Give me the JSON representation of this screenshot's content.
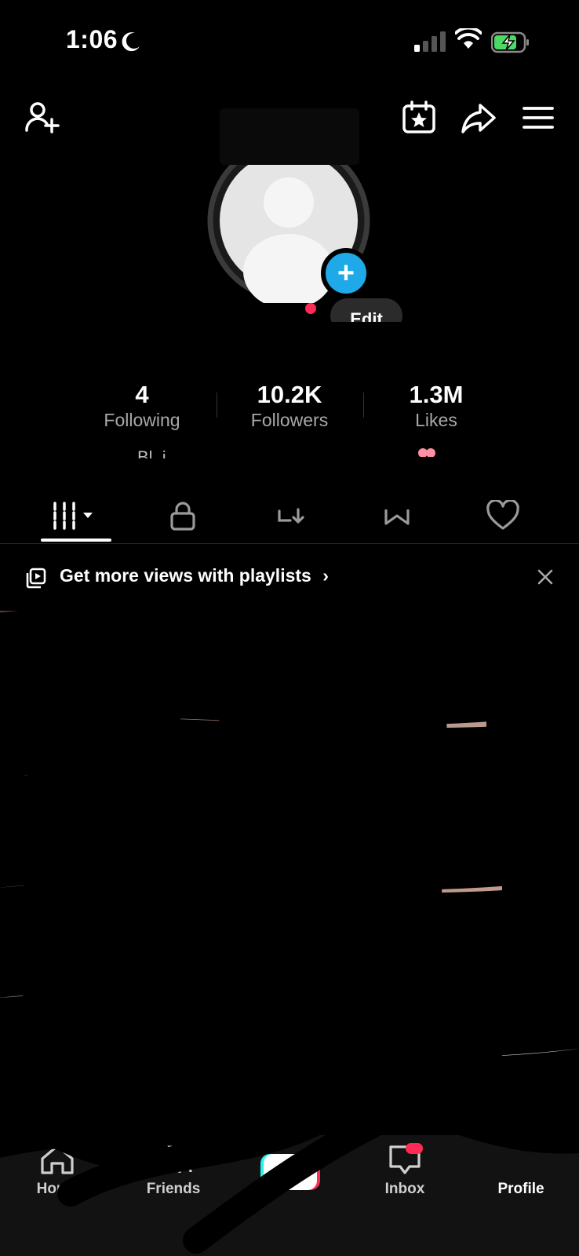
{
  "status_bar": {
    "time": "1:06"
  },
  "header": {
    "icons": [
      "add-friend-icon",
      "calendar-star-icon",
      "share-arrow-icon",
      "menu-icon"
    ]
  },
  "profile": {
    "edit_label": "Edit",
    "add_icon": "plus-icon",
    "accent_color": "#1fa9e8"
  },
  "stats": [
    {
      "value": "4",
      "label": "Following"
    },
    {
      "value": "10.2K",
      "label": "Followers"
    },
    {
      "value": "1.3M",
      "label": "Likes"
    }
  ],
  "bio_fragment": "Bl..i",
  "tabs": [
    {
      "name": "videos-grid",
      "icon": "grid-icon",
      "active": true
    },
    {
      "name": "private",
      "icon": "lock-icon"
    },
    {
      "name": "reposts",
      "icon": "repost-icon"
    },
    {
      "name": "bookmarks",
      "icon": "bookmark-icon"
    },
    {
      "name": "liked",
      "icon": "heart-icon"
    }
  ],
  "banner": {
    "text": "Get more views with playlists",
    "chevron": "›"
  },
  "bottom_nav": [
    {
      "label": "Home",
      "icon": "home-icon"
    },
    {
      "label": "Friends",
      "icon": "friends-icon"
    },
    {
      "label": "",
      "icon": "create-plus-icon"
    },
    {
      "label": "Inbox",
      "icon": "inbox-icon"
    },
    {
      "label": "Profile",
      "icon": "profile-icon",
      "active": true
    }
  ],
  "colors": {
    "background": "#000000",
    "accent_red": "#fe2c55",
    "accent_cyan": "#25f4ee",
    "text_secondary": "#a8a8a8"
  }
}
